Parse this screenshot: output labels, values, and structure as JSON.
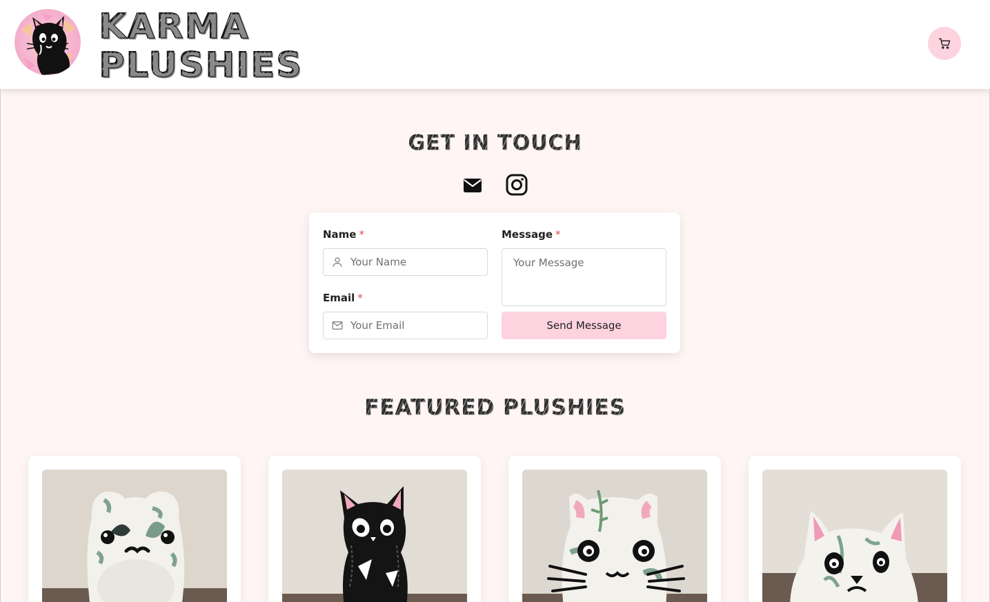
{
  "header": {
    "brand_line1": "KARMA",
    "brand_line2": "PLUSHIES",
    "logo_icon": "black-cat-logo-icon",
    "cart_icon": "shopping-cart-icon"
  },
  "contact": {
    "title": "GET IN TOUCH",
    "social": [
      "mail-icon",
      "instagram-icon"
    ],
    "name_label": "Name",
    "name_placeholder": "Your Name",
    "email_label": "Email",
    "email_placeholder": "Your Email",
    "message_label": "Message",
    "message_placeholder": "Your Message",
    "required_mark": "*",
    "send_label": "Send Message"
  },
  "featured": {
    "title": "FEATURED PLUSHIES",
    "products": [
      {
        "image": "white-floral-bear-plush"
      },
      {
        "image": "black-cat-plush-with-pink-ears"
      },
      {
        "image": "white-floral-cat-plush-with-whiskers"
      },
      {
        "image": "white-floral-cat-plush-with-pink-ears"
      }
    ]
  },
  "colors": {
    "accent_pink": "#fcd3df",
    "background": "#fff5f4",
    "required": "#e04848"
  }
}
